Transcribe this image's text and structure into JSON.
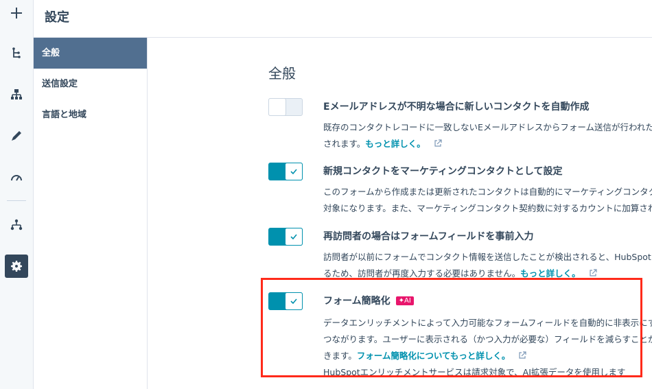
{
  "header": {
    "title": "設定"
  },
  "subnav": {
    "items": [
      {
        "label": "全般",
        "active": true
      },
      {
        "label": "送信設定",
        "active": false
      },
      {
        "label": "言語と地域",
        "active": false
      }
    ]
  },
  "section": {
    "title": "全般"
  },
  "settings": [
    {
      "title": "Eメールアドレスが不明な場合に新しいコンタクトを自動作成",
      "enabled": false,
      "desc_line1": "既存のコンタクトレコードに一致しないEメールアドレスからフォーム送信が行われた場合",
      "desc_line2": "されます。",
      "link": "もっと詳しく。"
    },
    {
      "title": "新規コンタクトをマーケティングコンタクトとして設定",
      "enabled": true,
      "desc_line1": "このフォームから作成または更新されたコンタクトは自動的にマーケティングコンタクト",
      "desc_line2": "対象になります。また、マーケティングコンタクト契約数に対するカウントに加算されます"
    },
    {
      "title": "再訪問者の場合はフォームフィールドを事前入力",
      "enabled": true,
      "desc_line1": "訪問者が以前にフォームでコンタクト情報を送信したことが検出されると、HubSpot",
      "desc_line2": "るため、訪問者が再度入力する必要はありません。",
      "link": "もっと詳しく。"
    },
    {
      "title": "フォーム簡略化",
      "badge": "✦AI",
      "enabled": true,
      "desc_line1": "データエンリッチメントによって入力可能なフォームフィールドを自動的に非表示にする",
      "desc_line2": "つながります。ユーザーに表示される（かつ入力が必要な）フィールドを減らすことがで",
      "desc_line3": "きます。",
      "link": "フォーム簡略化についてもっと詳しく。",
      "desc_line4": "HubSpotエンリッチメントサービスは請求対象で、AI拡張データを使用します"
    }
  ],
  "icons": {
    "rail": [
      "plus-icon",
      "workflow-icon",
      "org-chart-icon",
      "pencil-icon",
      "gauge-icon",
      "hierarchy-icon",
      "gear-icon"
    ],
    "external": "external-link-icon",
    "check": "checkmark-icon"
  },
  "colors": {
    "accent": "#0091ae",
    "text": "#33475b",
    "active_nav": "#516f90",
    "ai_badge": "#e8166c",
    "highlight": "#ff2a1a"
  }
}
